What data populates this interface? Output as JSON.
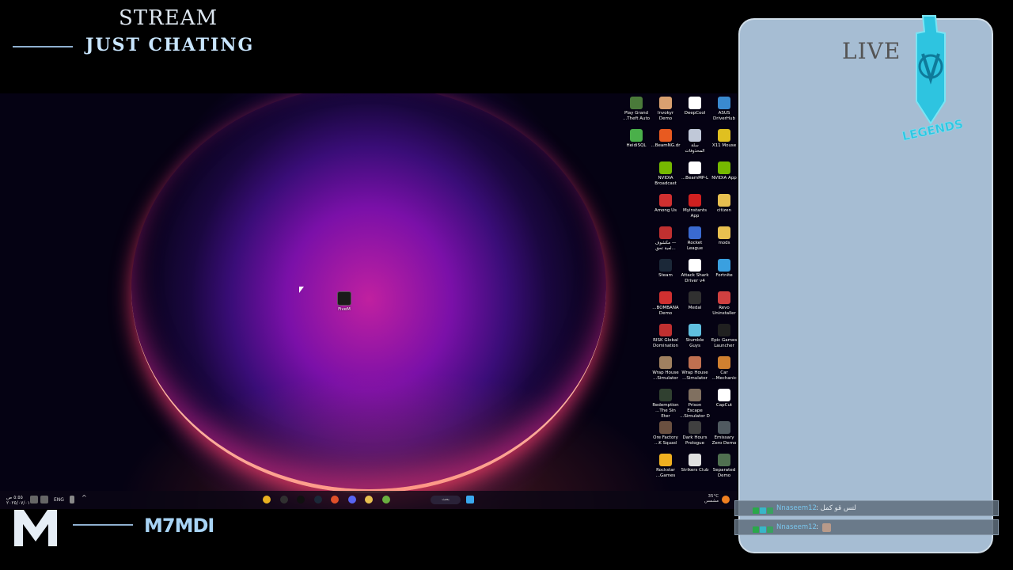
{
  "overlay": {
    "title": "STREAM",
    "subtitle": "JUST CHATING",
    "brand_name": "M7MDI",
    "live_label": "LIVE",
    "logo_text": "LEGENDS"
  },
  "desktop": {
    "center_icon": {
      "label": "FiveM",
      "color": "#1a1a1a"
    },
    "icons": [
      {
        "label": "Play Grand\n...Theft Auto",
        "color": "#4a7a3a",
        "col": 0,
        "row": 0
      },
      {
        "label": "Invokyr\nDemo",
        "color": "#d9a070",
        "col": 1,
        "row": 0
      },
      {
        "label": "DeepCool",
        "color": "#ffffff",
        "col": 2,
        "row": 0
      },
      {
        "label": "ASUS\nDriverHub",
        "color": "#3a8ad0",
        "col": 3,
        "row": 0
      },
      {
        "label": "HeidiSQL",
        "color": "#4ab04a",
        "col": 0,
        "row": 1
      },
      {
        "label": "...BeamNG.dr",
        "color": "#e85a20",
        "col": 1,
        "row": 1
      },
      {
        "label": "سلة\nالمحذوفات",
        "color": "#c0c8d8",
        "col": 2,
        "row": 1
      },
      {
        "label": "X11 Mouse",
        "color": "#e0c020",
        "col": 3,
        "row": 1
      },
      {
        "label": "NVIDIA\nBroadcast",
        "color": "#76b900",
        "col": 1,
        "row": 2
      },
      {
        "label": "...BeamMP-L",
        "color": "#ffffff",
        "col": 2,
        "row": 2
      },
      {
        "label": "NVIDIA App",
        "color": "#76b900",
        "col": 3,
        "row": 2
      },
      {
        "label": "Among Us",
        "color": "#d03030",
        "col": 1,
        "row": 3
      },
      {
        "label": "Myinstants\nApp",
        "color": "#d02020",
        "col": 2,
        "row": 3
      },
      {
        "label": "citizen",
        "color": "#e8c050",
        "col": 3,
        "row": 3
      },
      {
        "label": "مكشوف —\nلعبة تحق...",
        "color": "#c03030",
        "col": 1,
        "row": 4
      },
      {
        "label": "Rocket\nLeague",
        "color": "#3a6ad0",
        "col": 2,
        "row": 4
      },
      {
        "label": "mods",
        "color": "#e8c050",
        "col": 3,
        "row": 4
      },
      {
        "label": "Steam",
        "color": "#1b2838",
        "col": 1,
        "row": 5
      },
      {
        "label": "Attack Shark\nDriver v4",
        "color": "#ffffff",
        "col": 2,
        "row": 5
      },
      {
        "label": "Fortnite",
        "color": "#3aa0e0",
        "col": 3,
        "row": 5
      },
      {
        "label": "...BOMBANA\nDemo",
        "color": "#d03030",
        "col": 1,
        "row": 6
      },
      {
        "label": "Medal",
        "color": "#303030",
        "col": 2,
        "row": 6
      },
      {
        "label": "Revo\nUninstaller",
        "color": "#d04040",
        "col": 3,
        "row": 6
      },
      {
        "label": "RISK Global\nDomination",
        "color": "#c03030",
        "col": 1,
        "row": 7
      },
      {
        "label": "Stumble\nGuys",
        "color": "#60c0e0",
        "col": 2,
        "row": 7
      },
      {
        "label": "Epic Games\nLauncher",
        "color": "#202020",
        "col": 3,
        "row": 7
      },
      {
        "label": "Wrap House\n...Simulator",
        "color": "#a08060",
        "col": 1,
        "row": 8
      },
      {
        "label": "Wrap House\n...Simulator",
        "color": "#c07050",
        "col": 2,
        "row": 8
      },
      {
        "label": "Car\n...Mechanic",
        "color": "#d08030",
        "col": 3,
        "row": 8
      },
      {
        "label": "Redemption\n...The Sin Eter",
        "color": "#304030",
        "col": 1,
        "row": 9
      },
      {
        "label": "Prison Escape\n...Simulator D",
        "color": "#807060",
        "col": 2,
        "row": 9
      },
      {
        "label": "CapCut",
        "color": "#ffffff",
        "col": 3,
        "row": 9
      },
      {
        "label": "Ore Factory\n...K Squad",
        "color": "#6a5040",
        "col": 1,
        "row": 10
      },
      {
        "label": "Dark Hours\nPrologue",
        "color": "#404040",
        "col": 2,
        "row": 10
      },
      {
        "label": "Emissary\nZero Demo",
        "color": "#505a60",
        "col": 3,
        "row": 10
      },
      {
        "label": "Rockstar\n...Games",
        "color": "#f0b020",
        "col": 1,
        "row": 11
      },
      {
        "label": "Strikers Club",
        "color": "#e0e0e0",
        "col": 2,
        "row": 11
      },
      {
        "label": "Separated\nDemo",
        "color": "#507050",
        "col": 3,
        "row": 11
      }
    ]
  },
  "taskbar": {
    "time": "٥:٥٥ ص",
    "date": "٢٠٢٥/٠٧/٠١",
    "language": "ENG",
    "search_placeholder": "بحث",
    "temperature": "35°C",
    "weather": "مشمس",
    "pinned": [
      {
        "name": "chrome-icon",
        "color": "#e8b020"
      },
      {
        "name": "obs-icon",
        "color": "#303030"
      },
      {
        "name": "fivem-icon",
        "color": "#101010"
      },
      {
        "name": "steam-icon",
        "color": "#1b2838"
      },
      {
        "name": "brave-icon",
        "color": "#e0502a"
      },
      {
        "name": "discord-icon",
        "color": "#5865f2"
      },
      {
        "name": "folder-icon",
        "color": "#e8c050"
      },
      {
        "name": "game-icon",
        "color": "#6ab040"
      }
    ]
  },
  "chat": {
    "messages": [
      {
        "user": "Nnaseem12",
        "text": ": لتس قو كمل"
      },
      {
        "user": "Nnaseem12",
        "text": ":"
      }
    ]
  },
  "colors": {
    "panel_bg": "#a6bdd3",
    "accent": "#7ac7ee",
    "logo": "#2ec4e0"
  }
}
